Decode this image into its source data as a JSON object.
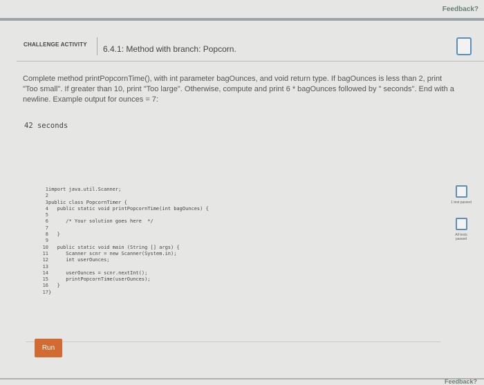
{
  "top": {
    "feedback": "Feedback?"
  },
  "header": {
    "activity_label": "CHALLENGE ACTIVITY",
    "title": "6.4.1: Method with branch: Popcorn."
  },
  "description": "Complete method printPopcornTime(), with int parameter bagOunces, and void return type. If bagOunces is less than 2, print \"Too small\". If greater than 10, print \"Too large\". Otherwise, compute and print 6 * bagOunces followed by \" seconds\". End with a newline. Example output for ounces = 7:",
  "example_output": "42 seconds",
  "editor": {
    "line_numbers": [
      "1",
      "2",
      "3",
      "4",
      "5",
      "6",
      "7",
      "8",
      "9",
      "10",
      "11",
      "12",
      "13",
      "14",
      "15",
      "16",
      "17"
    ],
    "lines": [
      "import java.util.Scanner;",
      "",
      "public class PopcornTimer {",
      "   public static void printPopcornTime(int bagOunces) {",
      "",
      "      /* Your solution goes here  */",
      "",
      "   }",
      "",
      "   public static void main (String [] args) {",
      "      Scanner scnr = new Scanner(System.in);",
      "      int userOunces;",
      "",
      "      userOunces = scnr.nextInt();",
      "      printPopcornTime(userOunces);",
      "   }",
      "}"
    ]
  },
  "tests": {
    "test1_label": "1 test passed",
    "all_label": "All tests passed"
  },
  "run_label": "Run",
  "bottom": {
    "feedback": "Feedback?"
  }
}
